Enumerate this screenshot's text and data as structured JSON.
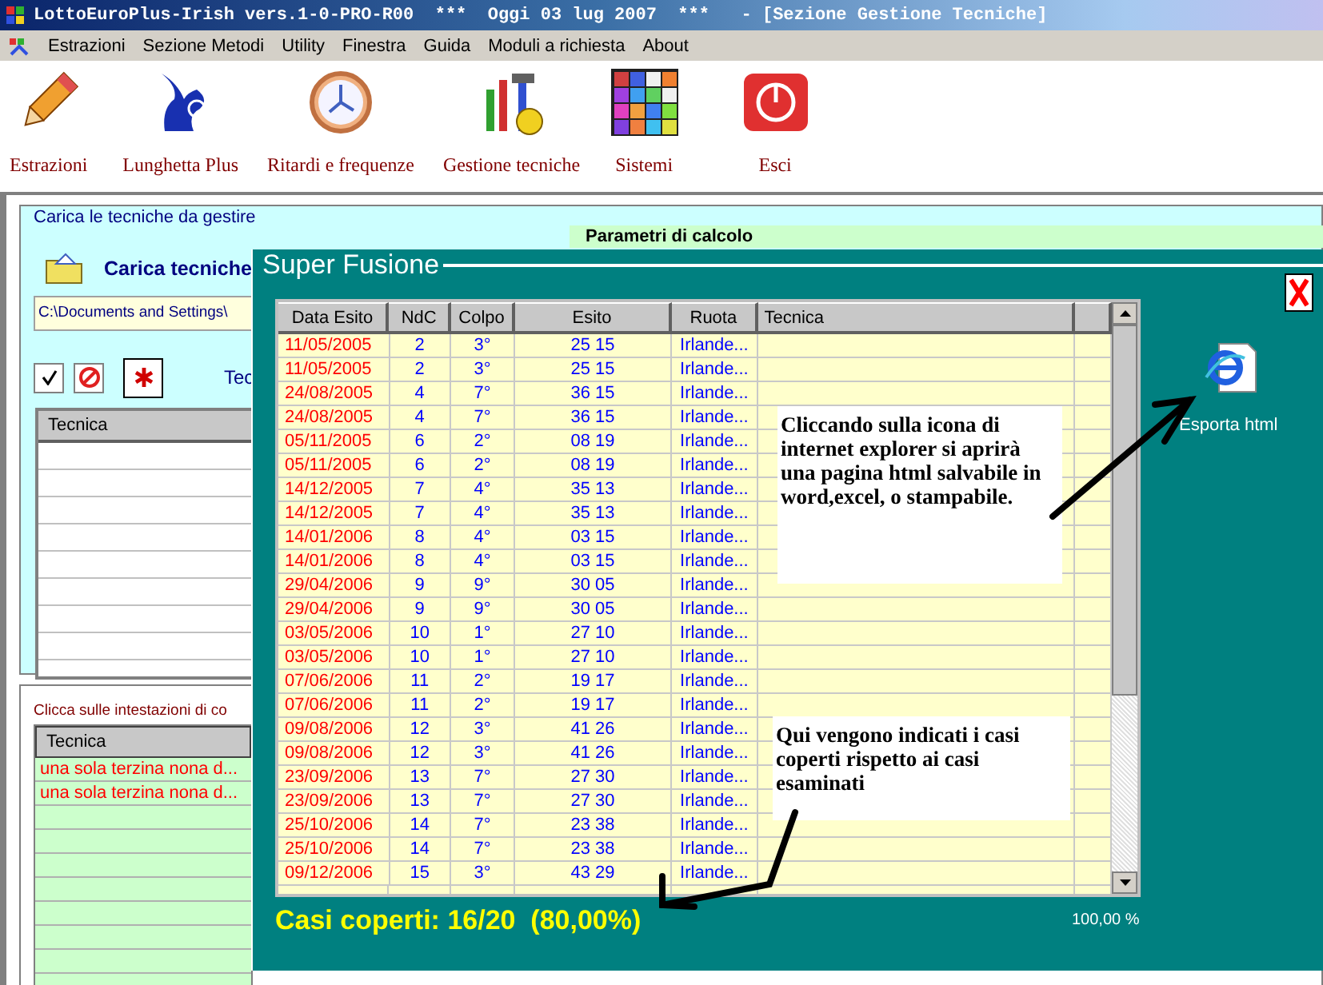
{
  "window": {
    "title": "LottoEuroPlus-Irish vers.1-0-PRO-R00  ***  Oggi 03 lug 2007  ***   - [Sezione Gestione Tecniche]"
  },
  "menu": [
    "Estrazioni",
    "Sezione Metodi",
    "Utility",
    "Finestra",
    "Guida",
    "Moduli a richiesta",
    "About"
  ],
  "toolbar": [
    {
      "label": "Estrazioni",
      "kind": "pencil"
    },
    {
      "label": "Lunghetta Plus",
      "kind": "figure"
    },
    {
      "label": "Ritardi e frequenze",
      "kind": "clock"
    },
    {
      "label": "Gestione tecniche",
      "kind": "tools"
    },
    {
      "label": "Sistemi",
      "kind": "grid"
    },
    {
      "label": "Esci",
      "kind": "power"
    }
  ],
  "load_panel": {
    "title": "Carica le tecniche da gestire",
    "load_label": "Carica tecniche",
    "path": "C:\\Documents and Settings\\",
    "tools_label": "Tec",
    "list_header": "Tecnica"
  },
  "params_panel": {
    "title": "Parametri di calcolo"
  },
  "results_panel": {
    "hint": "Clicca sulle intestazioni di co",
    "header": "Tecnica",
    "rows": [
      "una sola terzina nona d...",
      "una sola terzina nona d..."
    ]
  },
  "dialog": {
    "title": "Super Fusione",
    "columns": [
      "Data Esito",
      "NdC",
      "Colpo",
      "Esito",
      "Ruota",
      "Tecnica"
    ],
    "rows": [
      {
        "date": "11/05/2005",
        "ndc": "2",
        "colpo": "3°",
        "esito": "25 15",
        "ruota": "Irlande..."
      },
      {
        "date": "11/05/2005",
        "ndc": "2",
        "colpo": "3°",
        "esito": "25 15",
        "ruota": "Irlande..."
      },
      {
        "date": "24/08/2005",
        "ndc": "4",
        "colpo": "7°",
        "esito": "36 15",
        "ruota": "Irlande..."
      },
      {
        "date": "24/08/2005",
        "ndc": "4",
        "colpo": "7°",
        "esito": "36 15",
        "ruota": "Irlande..."
      },
      {
        "date": "05/11/2005",
        "ndc": "6",
        "colpo": "2°",
        "esito": "08 19",
        "ruota": "Irlande..."
      },
      {
        "date": "05/11/2005",
        "ndc": "6",
        "colpo": "2°",
        "esito": "08 19",
        "ruota": "Irlande..."
      },
      {
        "date": "14/12/2005",
        "ndc": "7",
        "colpo": "4°",
        "esito": "35 13",
        "ruota": "Irlande..."
      },
      {
        "date": "14/12/2005",
        "ndc": "7",
        "colpo": "4°",
        "esito": "35 13",
        "ruota": "Irlande..."
      },
      {
        "date": "14/01/2006",
        "ndc": "8",
        "colpo": "4°",
        "esito": "03 15",
        "ruota": "Irlande..."
      },
      {
        "date": "14/01/2006",
        "ndc": "8",
        "colpo": "4°",
        "esito": "03 15",
        "ruota": "Irlande..."
      },
      {
        "date": "29/04/2006",
        "ndc": "9",
        "colpo": "9°",
        "esito": "30 05",
        "ruota": "Irlande..."
      },
      {
        "date": "29/04/2006",
        "ndc": "9",
        "colpo": "9°",
        "esito": "30 05",
        "ruota": "Irlande..."
      },
      {
        "date": "03/05/2006",
        "ndc": "10",
        "colpo": "1°",
        "esito": "27 10",
        "ruota": "Irlande..."
      },
      {
        "date": "03/05/2006",
        "ndc": "10",
        "colpo": "1°",
        "esito": "27 10",
        "ruota": "Irlande..."
      },
      {
        "date": "07/06/2006",
        "ndc": "11",
        "colpo": "2°",
        "esito": "19 17",
        "ruota": "Irlande..."
      },
      {
        "date": "07/06/2006",
        "ndc": "11",
        "colpo": "2°",
        "esito": "19 17",
        "ruota": "Irlande..."
      },
      {
        "date": "09/08/2006",
        "ndc": "12",
        "colpo": "3°",
        "esito": "41 26",
        "ruota": "Irlande..."
      },
      {
        "date": "09/08/2006",
        "ndc": "12",
        "colpo": "3°",
        "esito": "41 26",
        "ruota": "Irlande..."
      },
      {
        "date": "23/09/2006",
        "ndc": "13",
        "colpo": "7°",
        "esito": "27 30",
        "ruota": "Irlande..."
      },
      {
        "date": "23/09/2006",
        "ndc": "13",
        "colpo": "7°",
        "esito": "27 30",
        "ruota": "Irlande..."
      },
      {
        "date": "25/10/2006",
        "ndc": "14",
        "colpo": "7°",
        "esito": "23 38",
        "ruota": "Irlande..."
      },
      {
        "date": "25/10/2006",
        "ndc": "14",
        "colpo": "7°",
        "esito": "23 38",
        "ruota": "Irlande..."
      },
      {
        "date": "09/12/2006",
        "ndc": "15",
        "colpo": "3°",
        "esito": "43 29",
        "ruota": "Irlande..."
      }
    ],
    "export_label": "Esporta html",
    "summary": "Casi coperti: 16/20  (80,00%)",
    "percent": "100,00 %",
    "notes": [
      "Cliccando sulla icona di internet explorer si aprirà una pagina html salvabile in word,excel, o stampabile.",
      "Qui vengono indicati i casi coperti rispetto ai casi esaminati"
    ]
  }
}
